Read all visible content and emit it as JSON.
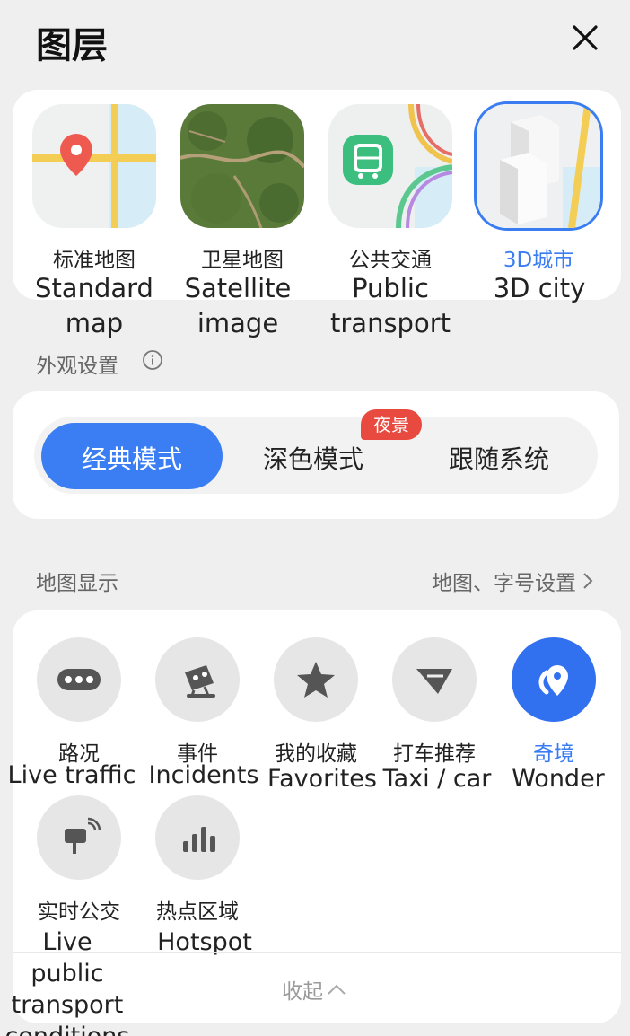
{
  "header": {
    "title": "图层"
  },
  "layers": [
    {
      "cn": "标准地图",
      "en": "Standard\nmap",
      "icon": "standard-map-icon"
    },
    {
      "cn": "卫星地图",
      "en": "Satellite\nimage",
      "icon": "satellite-map-icon"
    },
    {
      "cn": "公共交通",
      "en": "Public\ntransport",
      "icon": "public-transport-icon"
    },
    {
      "cn": "3D城市",
      "en": "3D city",
      "icon": "3d-city-icon",
      "selected": true
    }
  ],
  "appearance": {
    "label": "外观设置",
    "modes": [
      "经典模式",
      "深色模式",
      "跟随系统"
    ],
    "active_mode": "经典模式",
    "badge": "夜景"
  },
  "display": {
    "label": "地图显示",
    "settings_link": "地图、字号设置",
    "items": [
      {
        "cn": "路况",
        "en": "Live traffic",
        "icon": "traffic-icon"
      },
      {
        "cn": "事件",
        "en": "Incidents",
        "icon": "incident-icon"
      },
      {
        "cn": "我的收藏",
        "en": "Favorites",
        "icon": "star-icon"
      },
      {
        "cn": "打车推荐",
        "en": "Taxi / car",
        "icon": "taxi-icon"
      },
      {
        "cn": "奇境",
        "en": "Wonder",
        "icon": "wonder-icon",
        "active": true
      },
      {
        "cn": "实时公交",
        "en": "Live public\ntransport\nconditions",
        "icon": "bus-stop-icon"
      },
      {
        "cn": "热点区域",
        "en": "Hotspot",
        "icon": "hotspot-icon"
      }
    ],
    "collapse_label": "收起"
  },
  "colors": {
    "accent": "#3b7ef3",
    "badge": "#e84a3f",
    "background": "#efefef"
  }
}
